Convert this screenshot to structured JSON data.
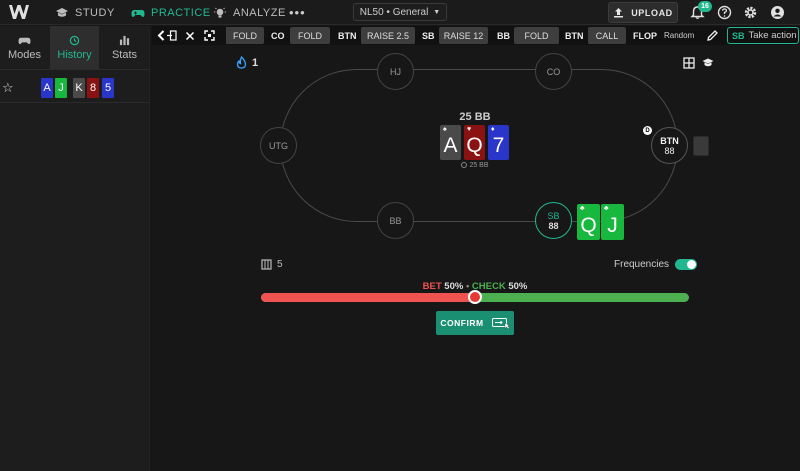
{
  "nav": {
    "study": "STUDY",
    "practice": "PRACTICE",
    "analyze": "ANALYZE",
    "more": "•••",
    "context": "NL50 • General",
    "upload": "UPLOAD",
    "notifications": "16"
  },
  "left_panel": {
    "tabs": [
      "Modes",
      "History",
      "Stats"
    ],
    "active_tab": "History",
    "history": [
      {
        "cards": [
          {
            "rank": "A",
            "color": "#2a36c9"
          },
          {
            "rank": "J",
            "color": "#18b83f"
          },
          {
            "rank": "K",
            "color": "#4a4a4a"
          },
          {
            "rank": "8",
            "color": "#8a1212"
          },
          {
            "rank": "5",
            "color": "#2a36c9"
          }
        ]
      }
    ]
  },
  "action_bar": {
    "actions": [
      {
        "action": "FOLD"
      },
      {
        "pos": "CO",
        "action": "FOLD"
      },
      {
        "pos": "BTN",
        "action": "RAISE 2.5"
      },
      {
        "pos": "SB",
        "action": "RAISE 12"
      },
      {
        "pos": "BB",
        "action": "FOLD"
      },
      {
        "pos": "BTN",
        "action": "CALL"
      },
      {
        "pos": "FLOP"
      }
    ],
    "random": "Random",
    "take_pos": "SB",
    "take_label": "Take action"
  },
  "table": {
    "seats": {
      "hj": "HJ",
      "co": "CO",
      "utg": "UTG",
      "bb": "BB",
      "btn": {
        "name": "BTN",
        "stack": "88"
      },
      "sb": {
        "name": "SB",
        "stack": "88"
      }
    },
    "pot_bb": "25 BB",
    "pot_small": "25 BB",
    "board": [
      {
        "rank": "A",
        "suit": "♠",
        "color": "#4a4a4a"
      },
      {
        "rank": "Q",
        "suit": "♥",
        "color": "#8a1212"
      },
      {
        "rank": "7",
        "suit": "♦",
        "color": "#2a36c9"
      }
    ],
    "hero_cards": [
      {
        "rank": "Q",
        "suit": "♣",
        "color": "#18b83f"
      },
      {
        "rank": "J",
        "suit": "♣",
        "color": "#18b83f"
      }
    ],
    "dealer": "D",
    "streak": "1"
  },
  "controls": {
    "hand_count": "5",
    "frequencies_label": "Frequencies",
    "bet_label": "BET",
    "bet_pct": "50%",
    "check_label": "CHECK",
    "check_pct": "50%",
    "bet_fraction": 0.5,
    "confirm": "CONFIRM"
  },
  "colors": {
    "accent": "#21b88f",
    "bet": "#ef5350",
    "check": "#4caf50"
  }
}
